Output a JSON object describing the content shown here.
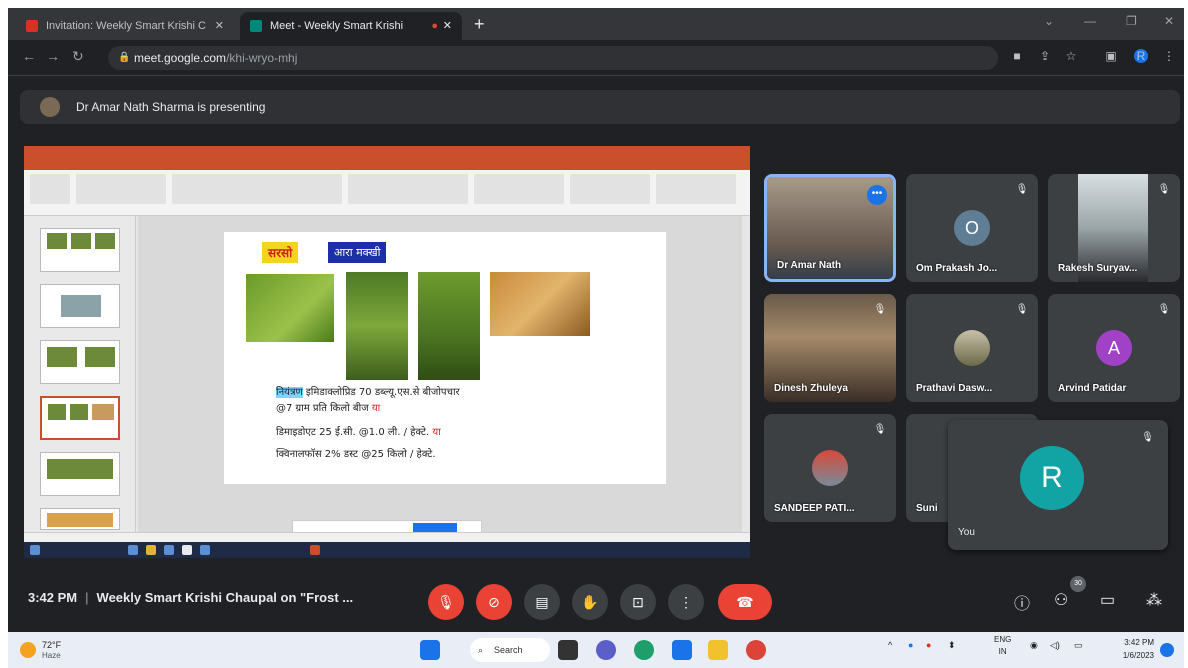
{
  "browser": {
    "tabs": [
      {
        "title": "Invitation: Weekly Smart Krishi C",
        "active": false
      },
      {
        "title": "Meet - Weekly Smart Krishi",
        "active": true
      }
    ],
    "new_tab": "+",
    "url_host": "meet.google.com",
    "url_path": "/khi-wryo-mhj"
  },
  "presenting": {
    "text": "Dr Amar Nath Sharma is presenting"
  },
  "shared_slide": {
    "label_crop": "सरसो",
    "label_pest": "आरा मक्खी",
    "line1_highlight": "नियंत्रण",
    "line1_rest": " इमिडाक्लोप्रिड 70 डब्ल्यू.एस.से बीजोपचार",
    "line2": "@7 ग्राम प्रति किलो बीज ",
    "line2_or": "या",
    "line3": "डिमाइडोएट 25 ई.सी. @1.0 ली. / हेक्टे. ",
    "line3_or": "या",
    "line4": "क्विनालफॉस 2% डस्ट @25 किलो / हेक्टे."
  },
  "participants": [
    {
      "name": "Dr Amar Nath",
      "type": "video"
    },
    {
      "name": "Om Prakash Jo...",
      "initial": "O",
      "color": "#5f7d95"
    },
    {
      "name": "Rakesh Suryav...",
      "type": "video"
    },
    {
      "name": "Dinesh Zhuleya",
      "type": "video"
    },
    {
      "name": "Prathavi Dasw...",
      "type": "photo"
    },
    {
      "name": "Arvind Patidar",
      "initial": "A",
      "color": "#a142c6"
    },
    {
      "name": "SANDEEP PATI...",
      "type": "photo"
    },
    {
      "name": "Suni",
      "type": "photo"
    }
  ],
  "self_tile": {
    "name": "You",
    "initial": "R",
    "color": "#12a4a4"
  },
  "meeting": {
    "time": "3:42 PM",
    "title": "Weekly Smart Krishi Chaupal on \"Frost ...",
    "people_count": "30"
  },
  "taskbar": {
    "temperature": "72°F",
    "weather": "Haze",
    "search": "Search",
    "lang_top": "ENG",
    "lang_bottom": "IN",
    "clock_time": "3:42 PM",
    "clock_date": "1/6/2023"
  }
}
